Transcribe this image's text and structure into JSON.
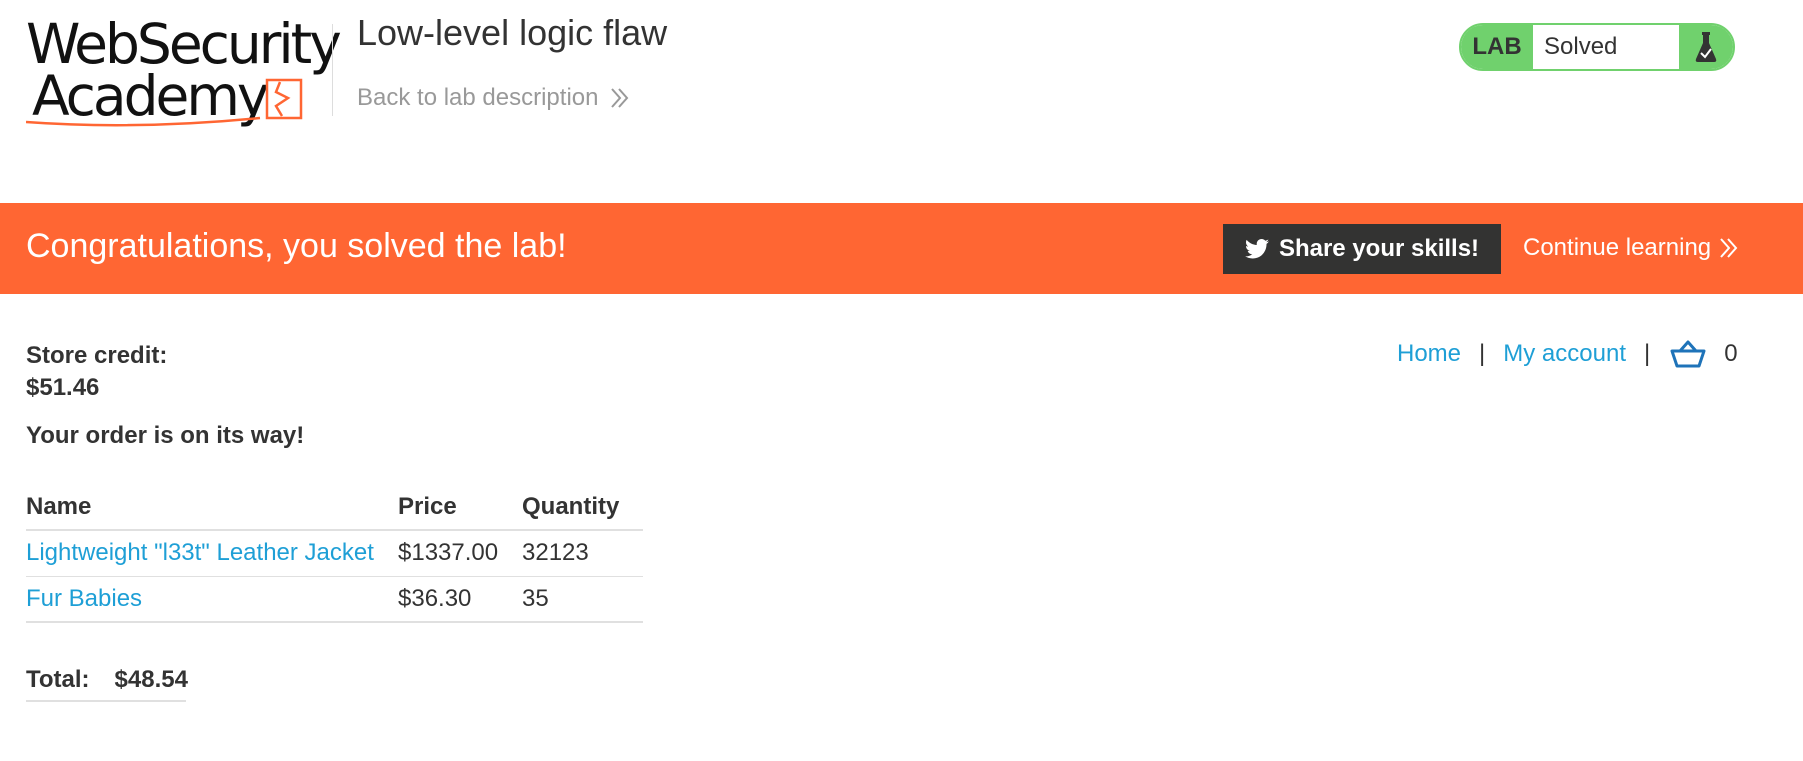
{
  "brand": {
    "logo_line1": "WebSecurity",
    "logo_line2": "Academy",
    "accent_color": "#ff6633"
  },
  "header": {
    "lab_title": "Low-level logic flaw",
    "back_link_label": "Back to lab description",
    "lab_badge": "LAB",
    "lab_status": "Solved",
    "status_color": "#70d16d"
  },
  "banner": {
    "message": "Congratulations, you solved the lab!",
    "share_label": "Share your skills!",
    "continue_label": "Continue learning"
  },
  "nav": {
    "home": "Home",
    "separator": "|",
    "my_account": "My account",
    "cart_count": "0",
    "cart_icon": "basket-icon"
  },
  "account": {
    "store_credit_label": "Store credit:",
    "store_credit_value": "$51.46",
    "order_message": "Your order is on its way!"
  },
  "order": {
    "columns": [
      "Name",
      "Price",
      "Quantity"
    ],
    "rows": [
      {
        "name": "Lightweight \"l33t\" Leather Jacket",
        "price": "$1337.00",
        "quantity": "32123"
      },
      {
        "name": "Fur Babies",
        "price": "$36.30",
        "quantity": "35"
      }
    ],
    "total_label": "Total:",
    "total_value": "$48.54"
  }
}
